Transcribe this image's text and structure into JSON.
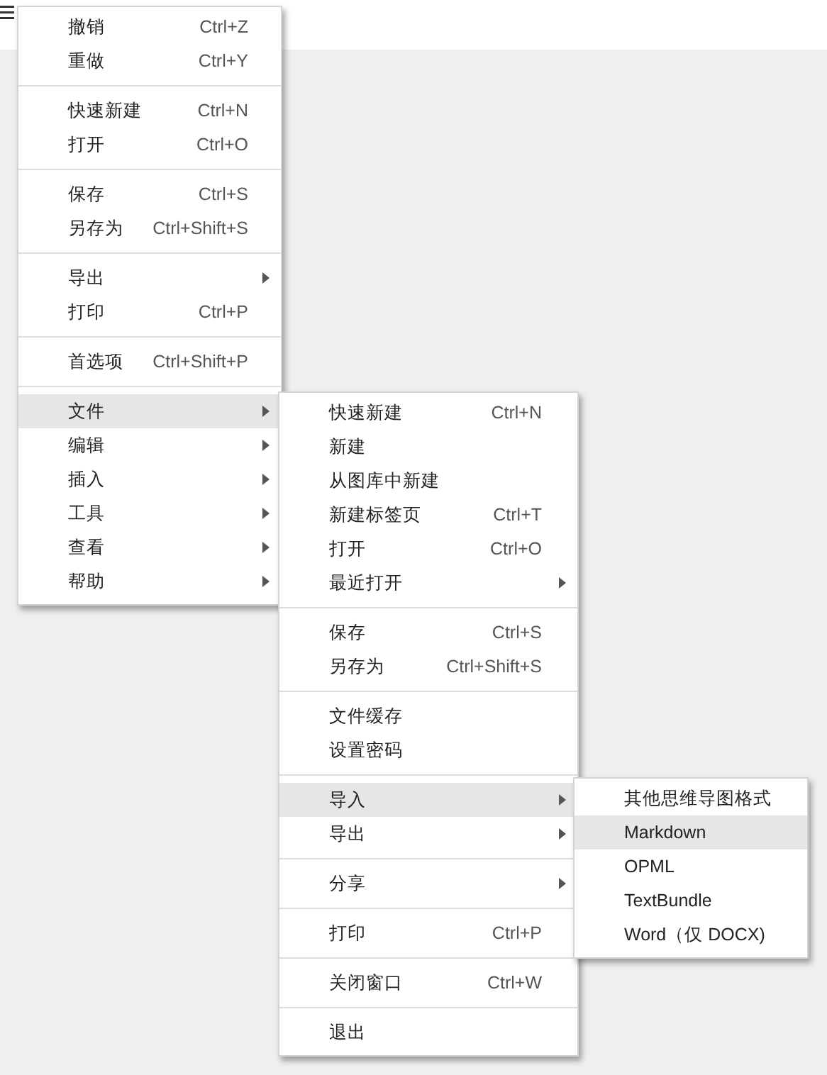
{
  "menus": [
    {
      "items": [
        {
          "kind": "item",
          "label": "撤销",
          "shortcut": "Ctrl+Z",
          "submenu": false,
          "selected": false
        },
        {
          "kind": "item",
          "label": "重做",
          "shortcut": "Ctrl+Y",
          "submenu": false,
          "selected": false
        },
        {
          "kind": "separator"
        },
        {
          "kind": "item",
          "label": "快速新建",
          "shortcut": "Ctrl+N",
          "submenu": false,
          "selected": false
        },
        {
          "kind": "item",
          "label": "打开",
          "shortcut": "Ctrl+O",
          "submenu": false,
          "selected": false
        },
        {
          "kind": "separator"
        },
        {
          "kind": "item",
          "label": "保存",
          "shortcut": "Ctrl+S",
          "submenu": false,
          "selected": false
        },
        {
          "kind": "item",
          "label": "另存为",
          "shortcut": "Ctrl+Shift+S",
          "submenu": false,
          "selected": false
        },
        {
          "kind": "separator"
        },
        {
          "kind": "item",
          "label": "导出",
          "submenu": true,
          "selected": false
        },
        {
          "kind": "item",
          "label": "打印",
          "shortcut": "Ctrl+P",
          "submenu": false,
          "selected": false
        },
        {
          "kind": "separator"
        },
        {
          "kind": "item",
          "label": "首选项",
          "shortcut": "Ctrl+Shift+P",
          "submenu": false,
          "selected": false
        },
        {
          "kind": "separator"
        },
        {
          "kind": "item",
          "label": "文件",
          "submenu": true,
          "selected": true
        },
        {
          "kind": "item",
          "label": "编辑",
          "submenu": true,
          "selected": false
        },
        {
          "kind": "item",
          "label": "插入",
          "submenu": true,
          "selected": false
        },
        {
          "kind": "item",
          "label": "工具",
          "submenu": true,
          "selected": false
        },
        {
          "kind": "item",
          "label": "查看",
          "submenu": true,
          "selected": false
        },
        {
          "kind": "item",
          "label": "帮助",
          "submenu": true,
          "selected": false
        }
      ]
    },
    {
      "items": [
        {
          "kind": "item",
          "label": "快速新建",
          "shortcut": "Ctrl+N",
          "submenu": false,
          "selected": false
        },
        {
          "kind": "item",
          "label": "新建",
          "submenu": false,
          "selected": false
        },
        {
          "kind": "item",
          "label": "从图库中新建",
          "submenu": false,
          "selected": false
        },
        {
          "kind": "item",
          "label": "新建标签页",
          "shortcut": "Ctrl+T",
          "submenu": false,
          "selected": false
        },
        {
          "kind": "item",
          "label": "打开",
          "shortcut": "Ctrl+O",
          "submenu": false,
          "selected": false
        },
        {
          "kind": "item",
          "label": "最近打开",
          "submenu": true,
          "selected": false
        },
        {
          "kind": "separator"
        },
        {
          "kind": "item",
          "label": "保存",
          "shortcut": "Ctrl+S",
          "submenu": false,
          "selected": false
        },
        {
          "kind": "item",
          "label": "另存为",
          "shortcut": "Ctrl+Shift+S",
          "submenu": false,
          "selected": false
        },
        {
          "kind": "separator"
        },
        {
          "kind": "item",
          "label": "文件缓存",
          "submenu": false,
          "selected": false
        },
        {
          "kind": "item",
          "label": "设置密码",
          "submenu": false,
          "selected": false
        },
        {
          "kind": "separator"
        },
        {
          "kind": "item",
          "label": "导入",
          "submenu": true,
          "selected": true
        },
        {
          "kind": "item",
          "label": "导出",
          "submenu": true,
          "selected": false
        },
        {
          "kind": "separator"
        },
        {
          "kind": "item",
          "label": "分享",
          "submenu": true,
          "selected": false
        },
        {
          "kind": "separator"
        },
        {
          "kind": "item",
          "label": "打印",
          "shortcut": "Ctrl+P",
          "submenu": false,
          "selected": false
        },
        {
          "kind": "separator"
        },
        {
          "kind": "item",
          "label": "关闭窗口",
          "shortcut": "Ctrl+W",
          "submenu": false,
          "selected": false
        },
        {
          "kind": "separator"
        },
        {
          "kind": "item",
          "label": "退出",
          "submenu": false,
          "selected": false
        }
      ]
    },
    {
      "items": [
        {
          "kind": "item",
          "label": "其他思维导图格式",
          "submenu": false,
          "selected": false
        },
        {
          "kind": "item",
          "label": "Markdown",
          "submenu": false,
          "selected": true
        },
        {
          "kind": "item",
          "label": "OPML",
          "submenu": false,
          "selected": false
        },
        {
          "kind": "item",
          "label": "TextBundle",
          "submenu": false,
          "selected": false
        },
        {
          "kind": "item",
          "label": "Word（仅 DOCX)",
          "submenu": false,
          "selected": false
        }
      ]
    }
  ]
}
